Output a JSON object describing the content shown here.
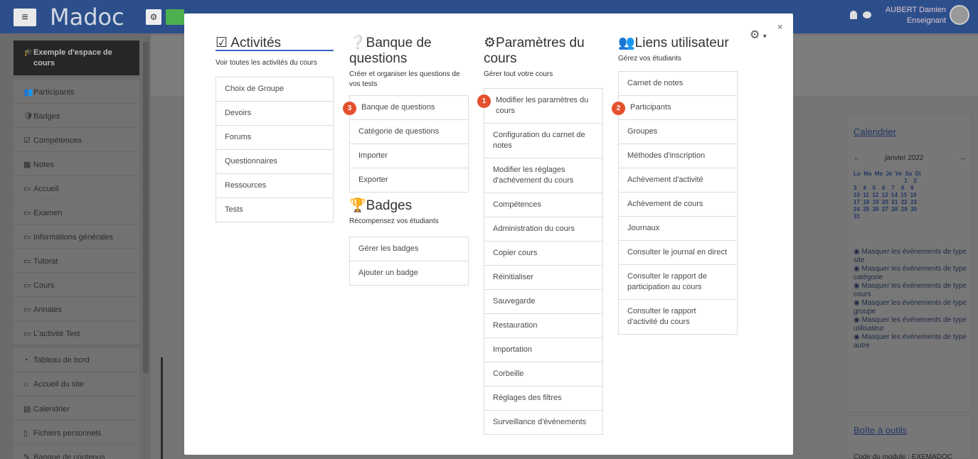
{
  "topbar": {
    "menu_icon": "hamburger-icon",
    "logo": "Madoc",
    "user_name": "AUBERT Damien",
    "user_role": "Enseignant"
  },
  "sidebar": {
    "items": [
      {
        "label": "Exemple d'espace de cours",
        "icon": "graduation-cap-icon"
      },
      {
        "label": "Participants",
        "icon": "users-icon"
      },
      {
        "label": "Badges",
        "icon": "shield-icon"
      },
      {
        "label": "Compétences",
        "icon": "check-square-icon"
      },
      {
        "label": "Notes",
        "icon": "table-icon"
      },
      {
        "label": "Accueil",
        "icon": "folder-icon"
      },
      {
        "label": "Examen",
        "icon": "folder-icon"
      },
      {
        "label": "Informations générales",
        "icon": "folder-icon"
      },
      {
        "label": "Tutorat",
        "icon": "folder-icon"
      },
      {
        "label": "Cours",
        "icon": "folder-icon"
      },
      {
        "label": "Annales",
        "icon": "folder-icon"
      },
      {
        "label": "L'activité Test",
        "icon": "folder-icon"
      },
      {
        "label": "Tableau de bord",
        "icon": "dashboard-icon"
      },
      {
        "label": "Accueil du site",
        "icon": "home-icon"
      },
      {
        "label": "Calendrier",
        "icon": "calendar-icon"
      },
      {
        "label": "Fichiers personnels",
        "icon": "file-icon"
      },
      {
        "label": "Banque de contenus",
        "icon": "pencil-icon"
      }
    ]
  },
  "calendar": {
    "title": "Calendrier",
    "month": "janvier 2022",
    "days_header": "Lu  Ma  Me  Je  Ve  Sa  Di",
    "rows": [
      "                                1    2",
      "3    4    5    6    7    8    9",
      "10  11  12  13  14  15  16",
      "17  18  19  20  21  22  23",
      "24  25  26  27  28  29  30",
      "31"
    ],
    "filters": [
      "Masquer les événements de type site",
      "Masquer les événements de type catégorie",
      "Masquer les événements de type cours",
      "Masquer les événements de type groupe",
      "Masquer les événements de type utilisateur",
      "Masquer les événements de type autre"
    ]
  },
  "toolbox": {
    "title": "Boîte à outils",
    "text": "Code du module : EXEMADOC"
  },
  "modal": {
    "close": "×",
    "activites": {
      "title": "Activités",
      "subtitle": "Voir toutes les activités du cours",
      "items": [
        "Choix de Groupe",
        "Devoirs",
        "Forums",
        "Questionnaires",
        "Ressources",
        "Tests"
      ]
    },
    "banque": {
      "title": "Banque de questions",
      "subtitle": "Créer et organiser les questions de vos tests",
      "items": [
        "Banque de questions",
        "Catégorie de questions",
        "Importer",
        "Exporter"
      ],
      "badge": "3"
    },
    "badges": {
      "title": "Badges",
      "subtitle": "Récompensez vos étudiants",
      "items": [
        "Gérer les badges",
        "Ajouter un badge"
      ]
    },
    "parametres": {
      "title": "Paramètres du cours",
      "subtitle": "Gérer tout votre cours",
      "items": [
        "Modifier les paramètres du cours",
        "Configuration du carnet de notes",
        "Modifier les réglages d'achèvement du cours",
        "Compétences",
        "Administration du cours",
        "Copier cours",
        "Réinitialiser",
        "Sauvegarde",
        "Restauration",
        "Importation",
        "Corbeille",
        "Réglages des filtres",
        "Surveillance d'événements"
      ],
      "badge": "1"
    },
    "liens": {
      "title": "Liens utilisateur",
      "subtitle": "Gérez vos étudiants",
      "items": [
        "Carnet de notes",
        "Participants",
        "Groupes",
        "Méthodes d'inscription",
        "Achèvement d'activité",
        "Achèvement de cours",
        "Journaux",
        "Consulter le journal en direct",
        "Consulter le rapport de participation au cours",
        "Consulter le rapport d'activité du cours"
      ],
      "badge": "2"
    }
  }
}
